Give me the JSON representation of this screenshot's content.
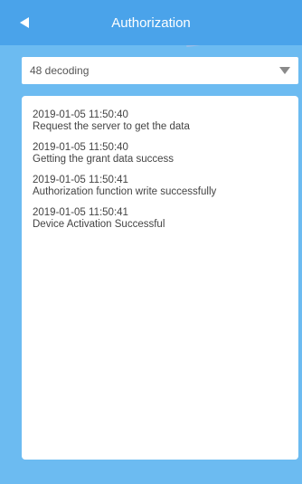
{
  "header": {
    "title": "Authorization",
    "back_icon": "back-arrow-icon"
  },
  "selector": {
    "value": "48 decoding",
    "caret_icon": "chevron-down-icon"
  },
  "log": {
    "entries": [
      {
        "time": "2019-01-05 11:50:40",
        "message": "Request the server to get the data"
      },
      {
        "time": "2019-01-05 11:50:40",
        "message": "Getting the grant data success"
      },
      {
        "time": "2019-01-05 11:50:41",
        "message": "Authorization function write successfully"
      },
      {
        "time": "2019-01-05 11:50:41",
        "message": "Device Activation Successful"
      }
    ]
  },
  "colors": {
    "header_bg": "#4aa3ea",
    "page_bg": "#6cbbf1",
    "card_bg": "#ffffff",
    "text": "#444444"
  }
}
